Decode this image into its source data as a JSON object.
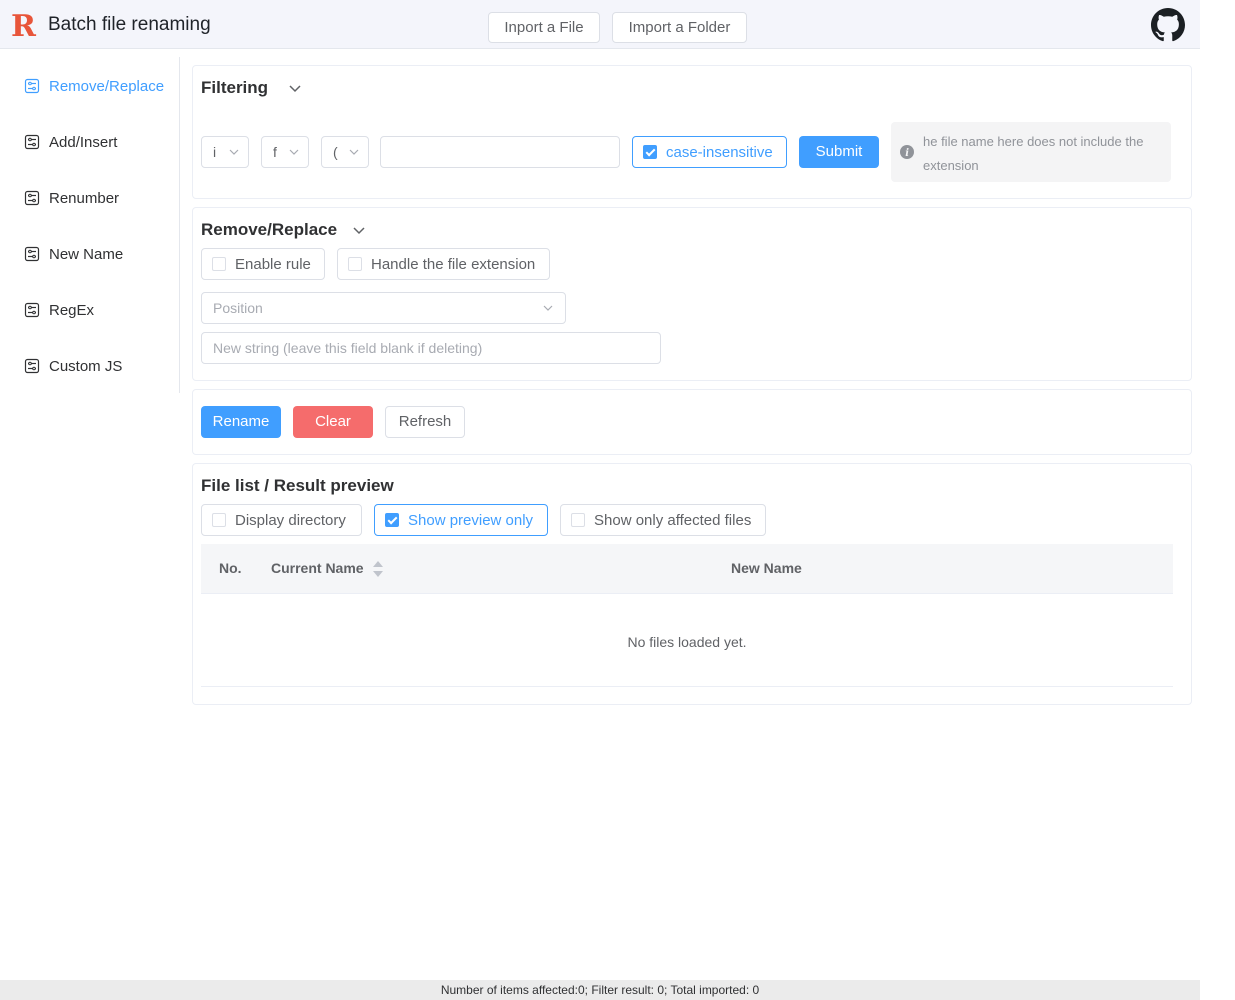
{
  "header": {
    "title": "Batch file renaming",
    "import_file_label": "Inport a File",
    "import_folder_label": "Import a Folder",
    "logo_icon": "logo-r-icon",
    "github_icon": "github-icon",
    "logo_color": "#e8553a"
  },
  "sidebar": {
    "items": [
      {
        "label": "Remove/Replace",
        "icon": "rule-icon",
        "active": true
      },
      {
        "label": "Add/Insert",
        "icon": "rule-icon",
        "active": false
      },
      {
        "label": "Renumber",
        "icon": "rule-icon",
        "active": false
      },
      {
        "label": "New Name",
        "icon": "rule-icon",
        "active": false
      },
      {
        "label": "RegEx",
        "icon": "rule-icon",
        "active": false
      },
      {
        "label": "Custom JS",
        "icon": "rule-icon",
        "active": false
      }
    ]
  },
  "filtering": {
    "title": "Filtering",
    "select1_value": "i",
    "select2_value": "f",
    "select3_value": "(",
    "filter_input_value": "",
    "case_insensitive_label": "case-insensitive",
    "case_insensitive_checked": true,
    "submit_label": "Submit",
    "info_text": "he file name here does not include the extension"
  },
  "remove_replace": {
    "title": "Remove/Replace",
    "enable_rule_label": "Enable rule",
    "handle_extension_label": "Handle the file extension",
    "position_placeholder": "Position",
    "new_string_placeholder": "New string (leave this field blank if deleting)"
  },
  "actions": {
    "rename_label": "Rename",
    "clear_label": "Clear",
    "refresh_label": "Refresh"
  },
  "file_list": {
    "title": "File list / Result preview",
    "display_directory_label": "Display directory",
    "show_preview_only_label": "Show preview only",
    "show_preview_only_checked": true,
    "show_affected_label": "Show only affected files",
    "columns": [
      "No.",
      "Current Name",
      "New Name"
    ],
    "empty_text": "No files loaded yet."
  },
  "footer": {
    "status": "Number of items affected:0; Filter result: 0; Total imported: 0"
  },
  "colors": {
    "primary": "#409eff",
    "danger": "#f56c6c"
  }
}
